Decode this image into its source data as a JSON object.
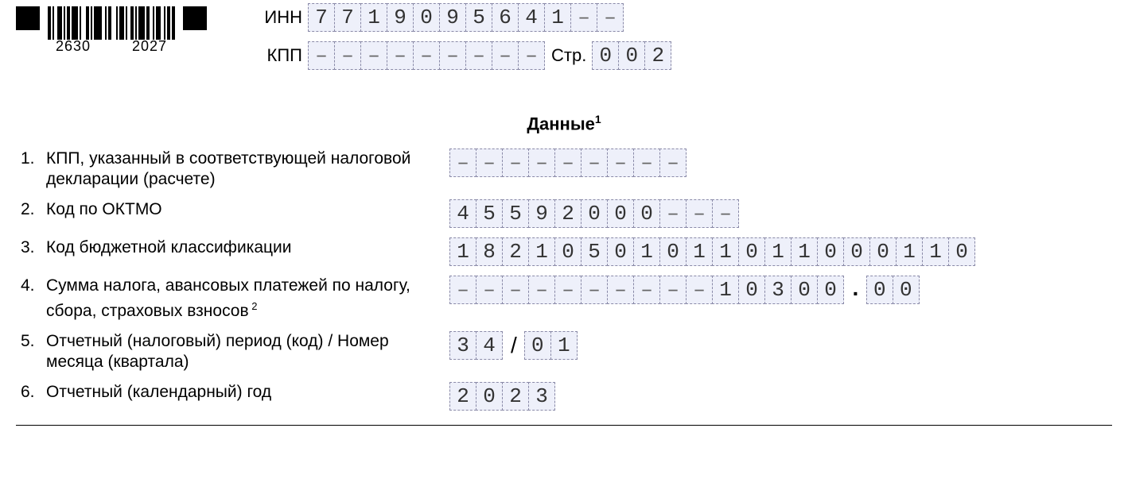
{
  "barcode": {
    "left": "2630",
    "right": "2027"
  },
  "labels": {
    "inn": "ИНН",
    "kpp": "КПП",
    "page": "Стр.",
    "section_title": "Данные",
    "section_sup": "1"
  },
  "header": {
    "inn": [
      "7",
      "7",
      "1",
      "9",
      "0",
      "9",
      "5",
      "6",
      "4",
      "1",
      "–",
      "–"
    ],
    "kpp": [
      "–",
      "–",
      "–",
      "–",
      "–",
      "–",
      "–",
      "–",
      "–"
    ],
    "page": [
      "0",
      "0",
      "2"
    ]
  },
  "rows": [
    {
      "num": "1.",
      "label": "КПП, указанный в соответствующей налоговой декларации (расчете)",
      "value_groups": [
        [
          "–",
          "–",
          "–",
          "–",
          "–",
          "–",
          "–",
          "–",
          "–"
        ]
      ]
    },
    {
      "num": "2.",
      "label": "Код по ОКТМО",
      "value_groups": [
        [
          "4",
          "5",
          "5",
          "9",
          "2",
          "0",
          "0",
          "0",
          "–",
          "–",
          "–"
        ]
      ]
    },
    {
      "num": "3.",
      "label": "Код бюджетной классификации",
      "value_groups": [
        [
          "1",
          "8",
          "2",
          "1",
          "0",
          "5",
          "0",
          "1",
          "0",
          "1",
          "1",
          "0",
          "1",
          "1",
          "0",
          "0",
          "0",
          "1",
          "1",
          "0"
        ]
      ]
    },
    {
      "num": "4.",
      "label": "Сумма налога, авансовых платежей по налогу, сбора, страховых взносов",
      "label_sup": "2",
      "value_groups": [
        [
          "–",
          "–",
          "–",
          "–",
          "–",
          "–",
          "–",
          "–",
          "–",
          "–",
          "1",
          "0",
          "3",
          "0",
          "0"
        ],
        [
          "0",
          "0"
        ]
      ],
      "sep": "."
    },
    {
      "num": "5.",
      "label": "Отчетный (налоговый) период (код) / Номер месяца (квартала)",
      "value_groups": [
        [
          "3",
          "4"
        ],
        [
          "0",
          "1"
        ]
      ],
      "sep": "/"
    },
    {
      "num": "6.",
      "label": "Отчетный (календарный) год",
      "value_groups": [
        [
          "2",
          "0",
          "2",
          "3"
        ]
      ]
    }
  ]
}
